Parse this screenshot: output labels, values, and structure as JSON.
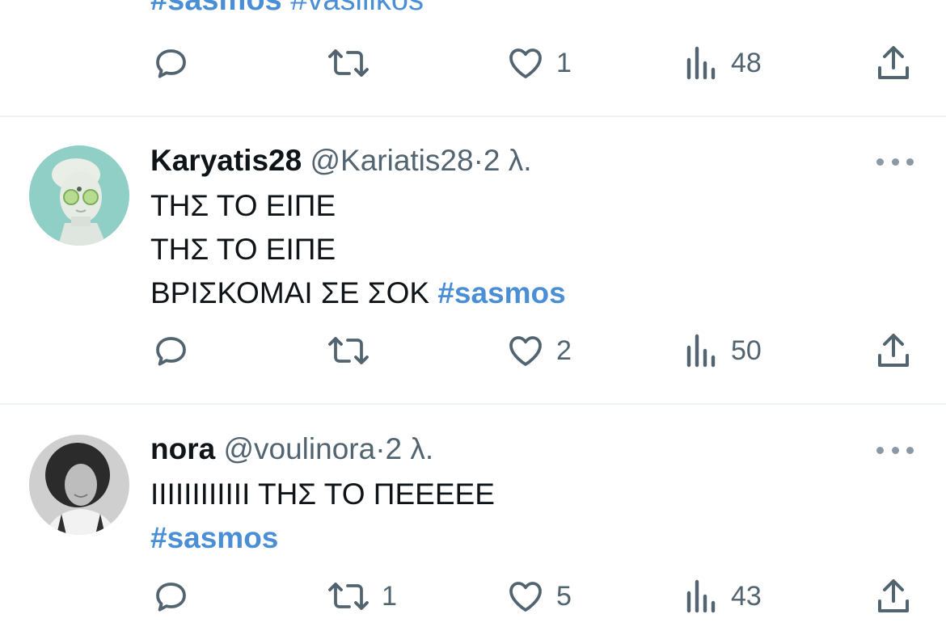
{
  "prev_tweet": {
    "tags_a": "#sasmos",
    "tags_b": "#vasilikos",
    "actions": {
      "reply": "",
      "retweet": "",
      "like": "1",
      "views": "48"
    }
  },
  "tweets": [
    {
      "name": "Karyatis28",
      "handle": "@Kariatis28",
      "dot": "·",
      "time": "2 λ.",
      "lines": [
        "ΤΗΣ ΤΟ ΕΙΠΕ",
        "ΤΗΣ ΤΟ ΕΙΠΕ",
        "ΒΡΙΣΚΟΜΑΙ ΣΕ ΣΟΚ"
      ],
      "hashtag": "#sasmos",
      "actions": {
        "reply": "",
        "retweet": "",
        "like": "2",
        "views": "50"
      }
    },
    {
      "name": "nora",
      "handle": "@voulinora",
      "dot": "·",
      "time": "2 λ.",
      "lines": [
        "ΙΙΙΙΙΙΙΙΙΙΙΙ ΤΗΣ ΤΟ ΠΕΕΕΕΕ"
      ],
      "hashtag": "#sasmos",
      "actions": {
        "reply": "",
        "retweet": "1",
        "like": "5",
        "views": "43"
      }
    }
  ],
  "colors": {
    "accent": "#4a8fd6",
    "text": "#0f1419",
    "muted": "#536471",
    "divider": "#eff3f4"
  },
  "icons": [
    "reply-icon",
    "retweet-icon",
    "like-icon",
    "views-icon",
    "share-icon",
    "more-icon"
  ]
}
